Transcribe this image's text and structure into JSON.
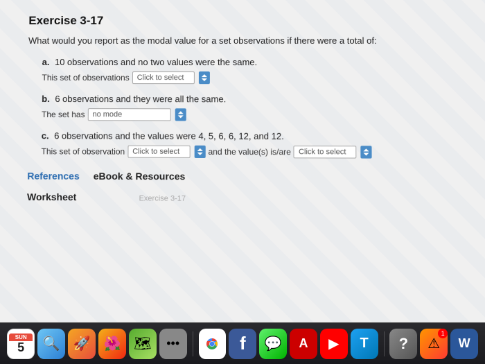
{
  "exercise": {
    "title": "Exercise 3-17",
    "intro": "What would you report as the modal value for a set observations if there were a total of:",
    "parts": [
      {
        "label": "a.",
        "text": "10 observations and no two values were the same.",
        "answer_prefix": "This set of observations",
        "answer_select": "Click to select",
        "answer_suffix": ""
      },
      {
        "label": "b.",
        "text": "6 observations and they were all the same.",
        "answer_prefix": "The set has",
        "answer_select": "no mode",
        "answer_suffix": ""
      },
      {
        "label": "c.",
        "text": "6 observations and the values were 4, 5, 6, 6, 12, and 12.",
        "answer_prefix": "This set of observation",
        "answer_select1": "Click to select",
        "answer_middle": "and the value(s) is/are",
        "answer_select2": "Click to select"
      }
    ],
    "references": {
      "label": "References",
      "ebook_label": "eBook & Resources"
    },
    "worksheet": {
      "label": "Worksheet",
      "exercise_small": "Exercise 3-17"
    }
  },
  "dock": {
    "calendar_month": "SUN",
    "calendar_day": "5",
    "items": [
      {
        "name": "Finder",
        "icon": "finder"
      },
      {
        "name": "Launchpad",
        "icon": "launchpad"
      },
      {
        "name": "Photos",
        "icon": "photos"
      },
      {
        "name": "Maps",
        "icon": "maps"
      },
      {
        "name": "More",
        "icon": "more"
      },
      {
        "name": "Chrome",
        "icon": "chrome"
      },
      {
        "name": "Facebook",
        "icon": "fb"
      },
      {
        "name": "Messages",
        "icon": "msg"
      },
      {
        "name": "Acrobat",
        "icon": "acrobat"
      },
      {
        "name": "YouTube",
        "icon": "youtube"
      },
      {
        "name": "Twitter",
        "icon": "t"
      },
      {
        "name": "Help",
        "icon": "help"
      },
      {
        "name": "Alert",
        "icon": "alert"
      },
      {
        "name": "Word",
        "icon": "word"
      }
    ]
  }
}
